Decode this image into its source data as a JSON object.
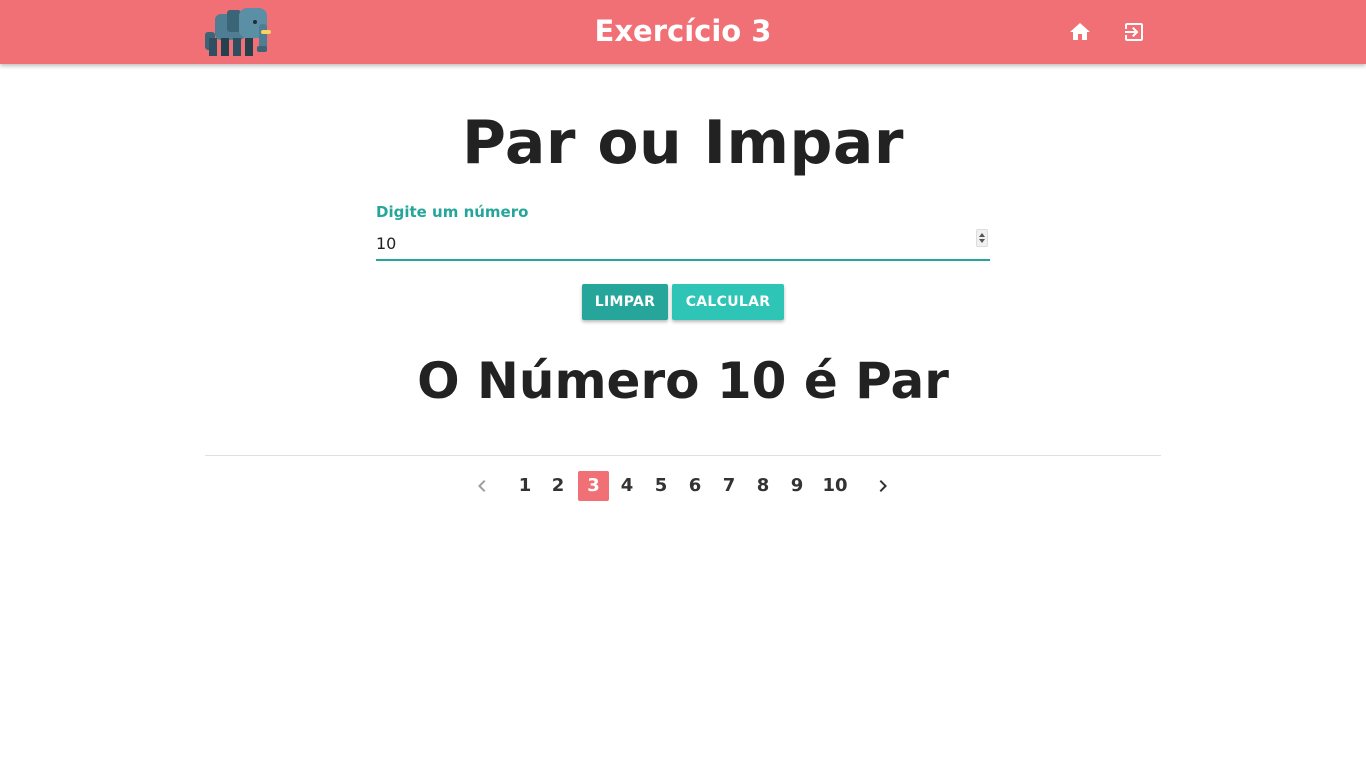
{
  "app": {
    "title": "Exercício 3",
    "logo_icon": "elephant-icon",
    "nav_icons": [
      "home-icon",
      "exit-icon"
    ],
    "brand_color": "#f07075",
    "accent_color": "#26a69a"
  },
  "main": {
    "heading": "Par ou Impar",
    "input": {
      "label": "Digite um número",
      "value": "10"
    },
    "buttons": {
      "clear_label": "LIMPAR",
      "calculate_label": "CALCULAR"
    },
    "result": "O Número 10 é Par"
  },
  "pagination": {
    "pages": [
      "1",
      "2",
      "3",
      "4",
      "5",
      "6",
      "7",
      "8",
      "9",
      "10"
    ],
    "current": "3",
    "prev_icon": "chevron-left-icon",
    "next_icon": "chevron-right-icon"
  }
}
